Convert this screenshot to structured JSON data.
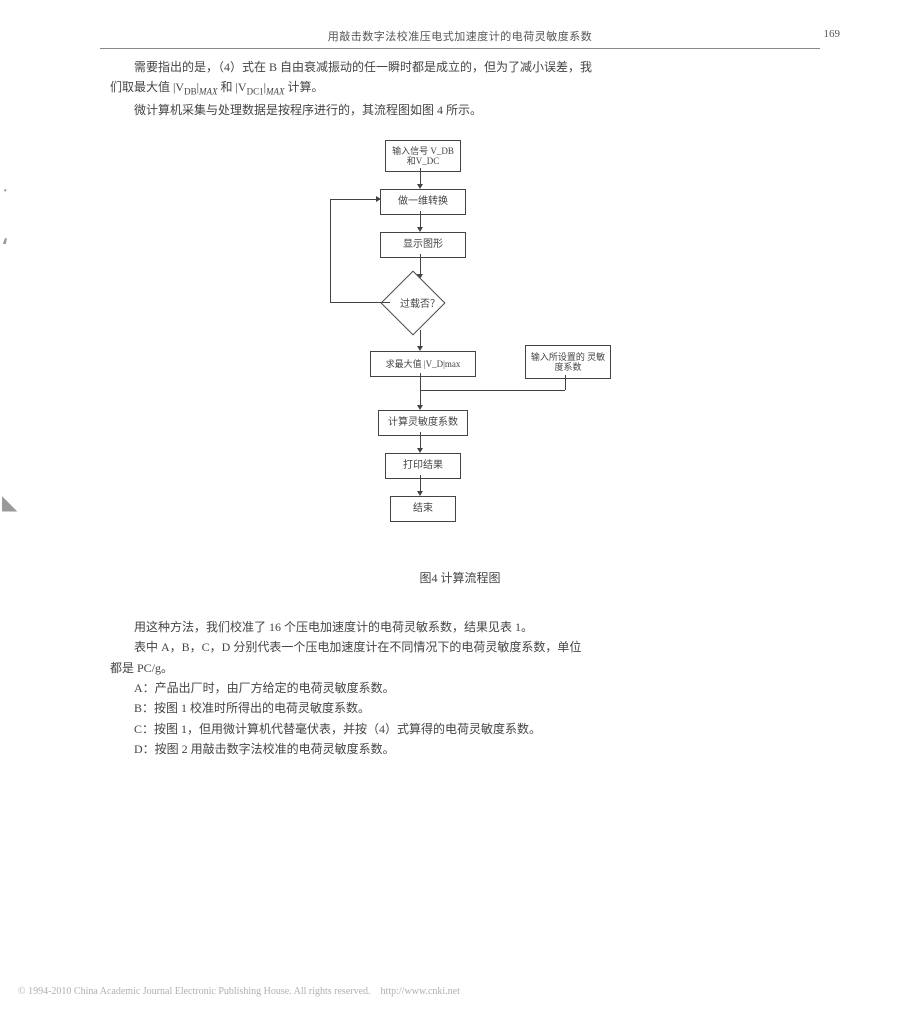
{
  "header": {
    "title": "用敲击数字法校准压电式加速度计的电荷灵敏度系数",
    "page_number": "169"
  },
  "paragraphs": {
    "p1a": "需要指出的是，（4）式在 B 自由衰减振动的任一瞬时都是成立的，但为了减小误差，我",
    "p1b": "们取最大值 |V",
    "p1b_sub1": "DB",
    "p1b_mid": "|",
    "p1b_sub1b": "MAX",
    "p1b_and": " 和 |V",
    "p1b_sub2": "DC1",
    "p1b_mid2": "|",
    "p1b_sub2b": "MAX",
    "p1b_end": " 计算。",
    "p2": "微计算机采集与处理数据是按程序进行的，其流程图如图 4 所示。",
    "p3": "用这种方法，我们校准了 16 个压电加速度计的电荷灵敏系数，结果见表 1。",
    "p4a": "表中 A，B，C，D 分别代表一个压电加速度计在不同情况下的电荷灵敏度系数，单位",
    "p4b": "都是 PC/g。",
    "pA": "A：产品出厂时，由厂方给定的电荷灵敏度系数。",
    "pB": "B：按图 1 校准时所得出的电荷灵敏度系数。",
    "pC": "C：按图 1，但用微计算机代替毫伏表，并按（4）式算得的电荷灵敏度系数。",
    "pD": "D：按图 2 用敲击数字法校准的电荷灵敏度系数。"
  },
  "flowchart": {
    "caption": "图4  计算流程图",
    "nodes": {
      "input": "输入信号\nV_DB和V_DC",
      "convert": "做一维转换",
      "display": "显示图形",
      "decision": "过载否？",
      "max": "求最大值 |V_D|max",
      "side_input": "输入所设置的\n灵敏度系数",
      "calc": "计算灵敏度系数",
      "print": "打印结果",
      "end": "结束"
    }
  },
  "footer": {
    "copyright": "© 1994-2010 China Academic Journal Electronic Publishing House. All rights reserved.",
    "url": "http://www.cnki.net"
  }
}
